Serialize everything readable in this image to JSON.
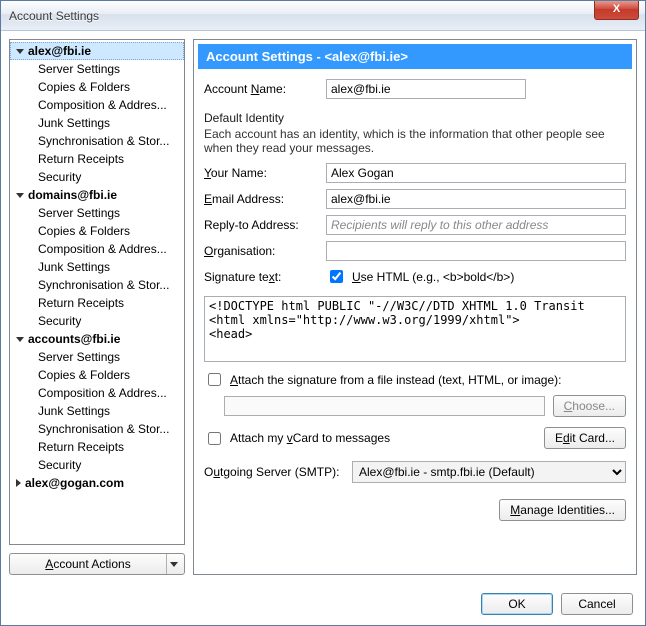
{
  "window": {
    "title": "Account Settings"
  },
  "close_x": "X",
  "tree": {
    "accounts": [
      {
        "name": "alex@fbi.ie",
        "expanded": true,
        "selected": true,
        "items": [
          "Server Settings",
          "Copies & Folders",
          "Composition & Addres...",
          "Junk Settings",
          "Synchronisation & Stor...",
          "Return Receipts",
          "Security"
        ]
      },
      {
        "name": "domains@fbi.ie",
        "expanded": true,
        "items": [
          "Server Settings",
          "Copies & Folders",
          "Composition & Addres...",
          "Junk Settings",
          "Synchronisation & Stor...",
          "Return Receipts",
          "Security"
        ]
      },
      {
        "name": "accounts@fbi.ie",
        "expanded": true,
        "items": [
          "Server Settings",
          "Copies & Folders",
          "Composition & Addres...",
          "Junk Settings",
          "Synchronisation & Stor...",
          "Return Receipts",
          "Security"
        ]
      },
      {
        "name": "alex@gogan.com",
        "expanded": false,
        "items": []
      }
    ]
  },
  "account_actions_label": "Account Actions",
  "panel": {
    "header_prefix": "Account Settings - ",
    "header_account": "<alex@fbi.ie>",
    "account_name_label": "Account Name:",
    "account_name_value": "alex@fbi.ie",
    "default_identity_label": "Default Identity",
    "identity_hint": "Each account has an identity, which is the information that other people see when they read your messages.",
    "your_name_label": "Your Name:",
    "your_name_value": "Alex Gogan",
    "email_label": "Email Address:",
    "email_value": "alex@fbi.ie",
    "replyto_label": "Reply-to Address:",
    "replyto_placeholder": "Recipients will reply to this other address",
    "org_label": "Organisation:",
    "org_value": "",
    "sig_label": "Signature text:",
    "use_html_label": "Use HTML (e.g., <b>bold</b>)",
    "sig_text": "<!DOCTYPE html PUBLIC \"-//W3C//DTD XHTML 1.0 Transit\n<html xmlns=\"http://www.w3.org/1999/xhtml\">\n<head>",
    "attach_file_label": "Attach the signature from a file instead (text, HTML, or image):",
    "choose_label": "Choose...",
    "attach_vcard_label": "Attach my vCard to messages",
    "edit_card_label": "Edit Card...",
    "smtp_label": "Outgoing Server (SMTP):",
    "smtp_value": "Alex@fbi.ie - smtp.fbi.ie (Default)",
    "manage_identities_label": "Manage Identities..."
  },
  "buttons": {
    "ok": "OK",
    "cancel": "Cancel"
  },
  "underline": {
    "accnt_name": "N",
    "your_name": "Y",
    "email": "E",
    "org": "O",
    "sigtext": "x",
    "usehtml": "U",
    "attachfile": "A",
    "choose": "C",
    "vcard": "v",
    "editcard": "d",
    "smtp": "u",
    "manage": "M",
    "acct_actions": "A"
  }
}
